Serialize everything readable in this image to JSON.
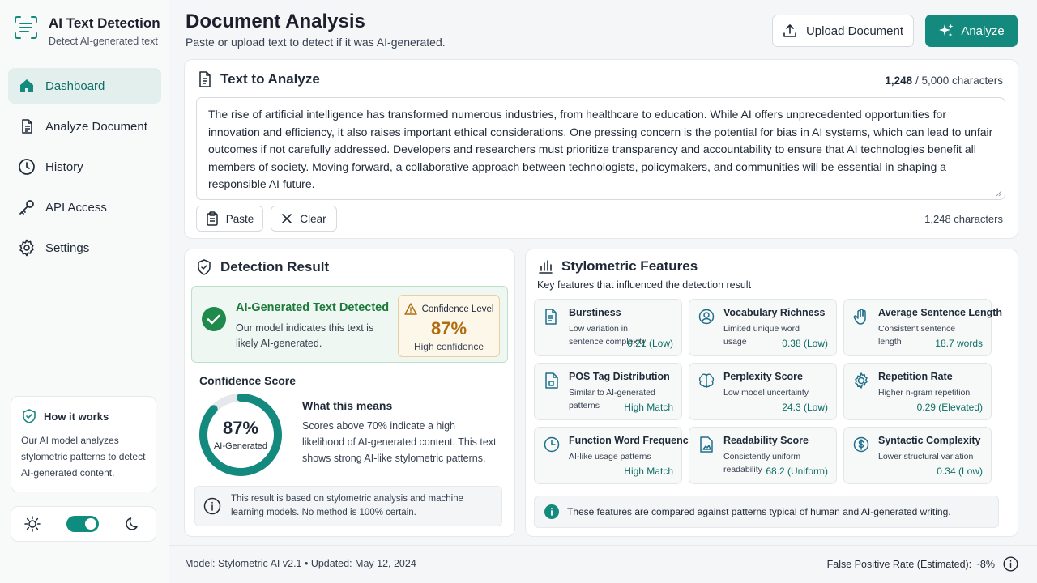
{
  "sidebar": {
    "brand_title": "AI Text Detection",
    "brand_subtitle": "Detect AI-generated text",
    "nav": [
      {
        "label": "Dashboard",
        "icon": "home-icon",
        "active": true
      },
      {
        "label": "Analyze Document",
        "icon": "document-icon"
      },
      {
        "label": "History",
        "icon": "clock-icon"
      },
      {
        "label": "API Access",
        "icon": "key-icon"
      },
      {
        "label": "Settings",
        "icon": "gear-icon"
      }
    ],
    "how_it_works": {
      "title": "How it works",
      "text": "Our AI model analyzes stylometric patterns to detect AI-generated content."
    },
    "theme": {
      "light_icon": "sun-icon",
      "dark_icon": "moon-icon",
      "dark_mode": true
    }
  },
  "header": {
    "title": "Document Analysis",
    "subtitle": "Paste or upload text to detect if it was AI-generated.",
    "upload_label": "Upload Document",
    "analyze_label": "Analyze"
  },
  "analyze": {
    "title": "Text to Analyze",
    "char_count": "1,248",
    "char_limit": "/ 5,000 characters",
    "text": "The rise of artificial intelligence has transformed numerous industries, from healthcare to education. While AI offers unprecedented opportunities for innovation and efficiency, it also raises important ethical considerations. One pressing concern is the potential for bias in AI systems, which can lead to unfair outcomes if not carefully addressed. Developers and researchers must prioritize transparency and accountability to ensure that AI technologies benefit all members of society. Moving forward, a collaborative approach between technologists, policymakers, and communities will be essential in shaping a responsible AI future.",
    "paste_label": "Paste",
    "clear_label": "Clear",
    "char_count_bottom": "1,248 characters"
  },
  "result": {
    "title": "Detection Result",
    "detect_title": "AI-Generated Text Detected",
    "detect_desc": "Our model indicates this text is likely AI-generated.",
    "confidence_label": "Confidence Level",
    "confidence_value": "87%",
    "confidence_sub": "High confidence",
    "score_title": "Confidence Score",
    "score_value": "87%",
    "score_fraction": 0.87,
    "score_label": "AI-Generated",
    "means_title": "What this means",
    "means_desc": "Scores above 70% indicate a high likelihood of AI-generated content. This text shows strong AI-like stylometric patterns.",
    "note": "This result is based on stylometric analysis and machine learning models. No method is 100% certain."
  },
  "stylometric": {
    "title": "Stylometric Features",
    "subtitle": "Key features that influenced the detection result",
    "features": [
      {
        "title": "Burstiness",
        "desc": "Low variation in sentence complexity",
        "value": "0.21 (Low)",
        "icon": "document-lines-icon"
      },
      {
        "title": "Vocabulary Richness",
        "desc": "Limited unique word usage",
        "value": "0.38 (Low)",
        "icon": "user-search-icon"
      },
      {
        "title": "Average Sentence Length",
        "desc": "Consistent sentence length",
        "value": "18.7 words",
        "icon": "hand-icon"
      },
      {
        "title": "POS Tag Distribution",
        "desc": "Similar to AI-generated patterns",
        "value": "High Match",
        "icon": "document-tag-icon"
      },
      {
        "title": "Perplexity Score",
        "desc": "Low model uncertainty",
        "value": "24.3 (Low)",
        "icon": "brain-icon"
      },
      {
        "title": "Repetition Rate",
        "desc": "Higher n-gram repetition",
        "value": "0.29 (Elevated)",
        "icon": "gear-cycle-icon"
      },
      {
        "title": "Function Word Frequency",
        "desc": "AI-like usage patterns",
        "value": "High Match",
        "icon": "clock-gauge-icon"
      },
      {
        "title": "Readability Score",
        "desc": "Consistently uniform readability",
        "value": "68.2 (Uniform)",
        "icon": "image-doc-icon"
      },
      {
        "title": "Syntactic Complexity",
        "desc": "Lower structural variation",
        "value": "0.34 (Low)",
        "icon": "dollar-circle-icon"
      }
    ],
    "info": "These features are compared against patterns typical of human and AI-generated writing."
  },
  "footer": {
    "model": "Model: Stylometric AI v2.1  •  Updated: May 12, 2024",
    "fpr": "False Positive Rate (Estimated): ~8%"
  },
  "colors": {
    "accent": "#138a7d",
    "success": "#1d7a3a",
    "warning": "#b06d10"
  }
}
